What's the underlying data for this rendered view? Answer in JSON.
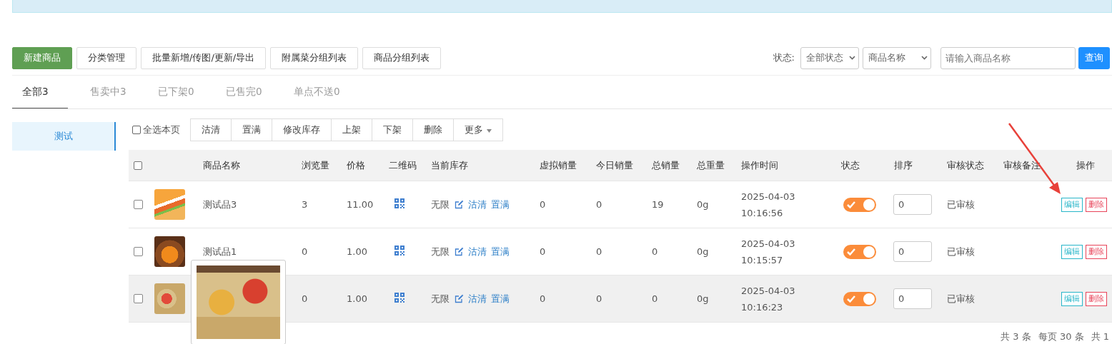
{
  "toolbar": {
    "buttons": [
      {
        "label": "新建商品",
        "kind": "primary"
      },
      {
        "label": "分类管理",
        "kind": "default"
      },
      {
        "label": "批量新增/传图/更新/导出",
        "kind": "default"
      },
      {
        "label": "附属菜分组列表",
        "kind": "default"
      },
      {
        "label": "商品分组列表",
        "kind": "default"
      }
    ],
    "filter_label": "状态:",
    "status_select": "全部状态",
    "field_select": "商品名称",
    "search": {
      "placeholder": "请输入商品名称"
    },
    "search_button": "查询"
  },
  "tabs": [
    {
      "label": "全部3",
      "selected": true
    },
    {
      "label": "售卖中3",
      "selected": false
    },
    {
      "label": "已下架0",
      "selected": false
    },
    {
      "label": "已售完0",
      "selected": false
    },
    {
      "label": "单点不送0",
      "selected": false
    }
  ],
  "sidebar": {
    "items": [
      {
        "label": "测试",
        "selected": true
      }
    ]
  },
  "bulk_bar": {
    "select_all": {
      "label": "全选本页",
      "checked": false
    },
    "buttons": [
      {
        "label": "沽清",
        "kind": "plain"
      },
      {
        "label": "置满",
        "kind": "plain"
      },
      {
        "label": "修改库存",
        "kind": "plain"
      },
      {
        "label": "上架",
        "kind": "plain"
      },
      {
        "label": "下架",
        "kind": "plain"
      },
      {
        "label": "删除",
        "kind": "plain"
      },
      {
        "label": "更多",
        "kind": "dropdown"
      }
    ]
  },
  "table": {
    "header_checked": false,
    "columns": [
      "商品名称",
      "浏览量",
      "价格",
      "二维码",
      "当前库存",
      "虚拟销量",
      "今日销量",
      "总销量",
      "总重量",
      "操作时间",
      "状态",
      "排序",
      "审核状态",
      "审核备注",
      "操作"
    ],
    "rows": [
      {
        "checked": false,
        "highlighted": false,
        "name": "测试品3",
        "views": "3",
        "price": "11.00",
        "stock": "无限",
        "sell_out": "沽清",
        "fill": "置满",
        "virtual_sales": "0",
        "today_sales": "0",
        "total_sales": "19",
        "weight": "0g",
        "date": "2025-04-03",
        "time": "10:16:56",
        "on": true,
        "sort": "0",
        "audit": "已审核",
        "edit": "编辑",
        "delete": "删除"
      },
      {
        "checked": false,
        "highlighted": false,
        "name": "测试品1",
        "views": "0",
        "price": "1.00",
        "stock": "无限",
        "sell_out": "沽清",
        "fill": "置满",
        "virtual_sales": "0",
        "today_sales": "0",
        "total_sales": "0",
        "weight": "0g",
        "date": "2025-04-03",
        "time": "10:15:57",
        "on": true,
        "sort": "0",
        "audit": "已审核",
        "edit": "编辑",
        "delete": "删除"
      },
      {
        "checked": false,
        "highlighted": true,
        "views": "0",
        "price": "1.00",
        "stock": "无限",
        "sell_out": "沽清",
        "fill": "置满",
        "virtual_sales": "0",
        "today_sales": "0",
        "total_sales": "0",
        "weight": "0g",
        "date": "2025-04-03",
        "time": "10:16:23",
        "on": true,
        "sort": "0",
        "audit": "已审核",
        "edit": "编辑",
        "delete": "删除"
      }
    ]
  },
  "pagination": [
    "共 3 条",
    "每页 30 条",
    "共 1"
  ]
}
